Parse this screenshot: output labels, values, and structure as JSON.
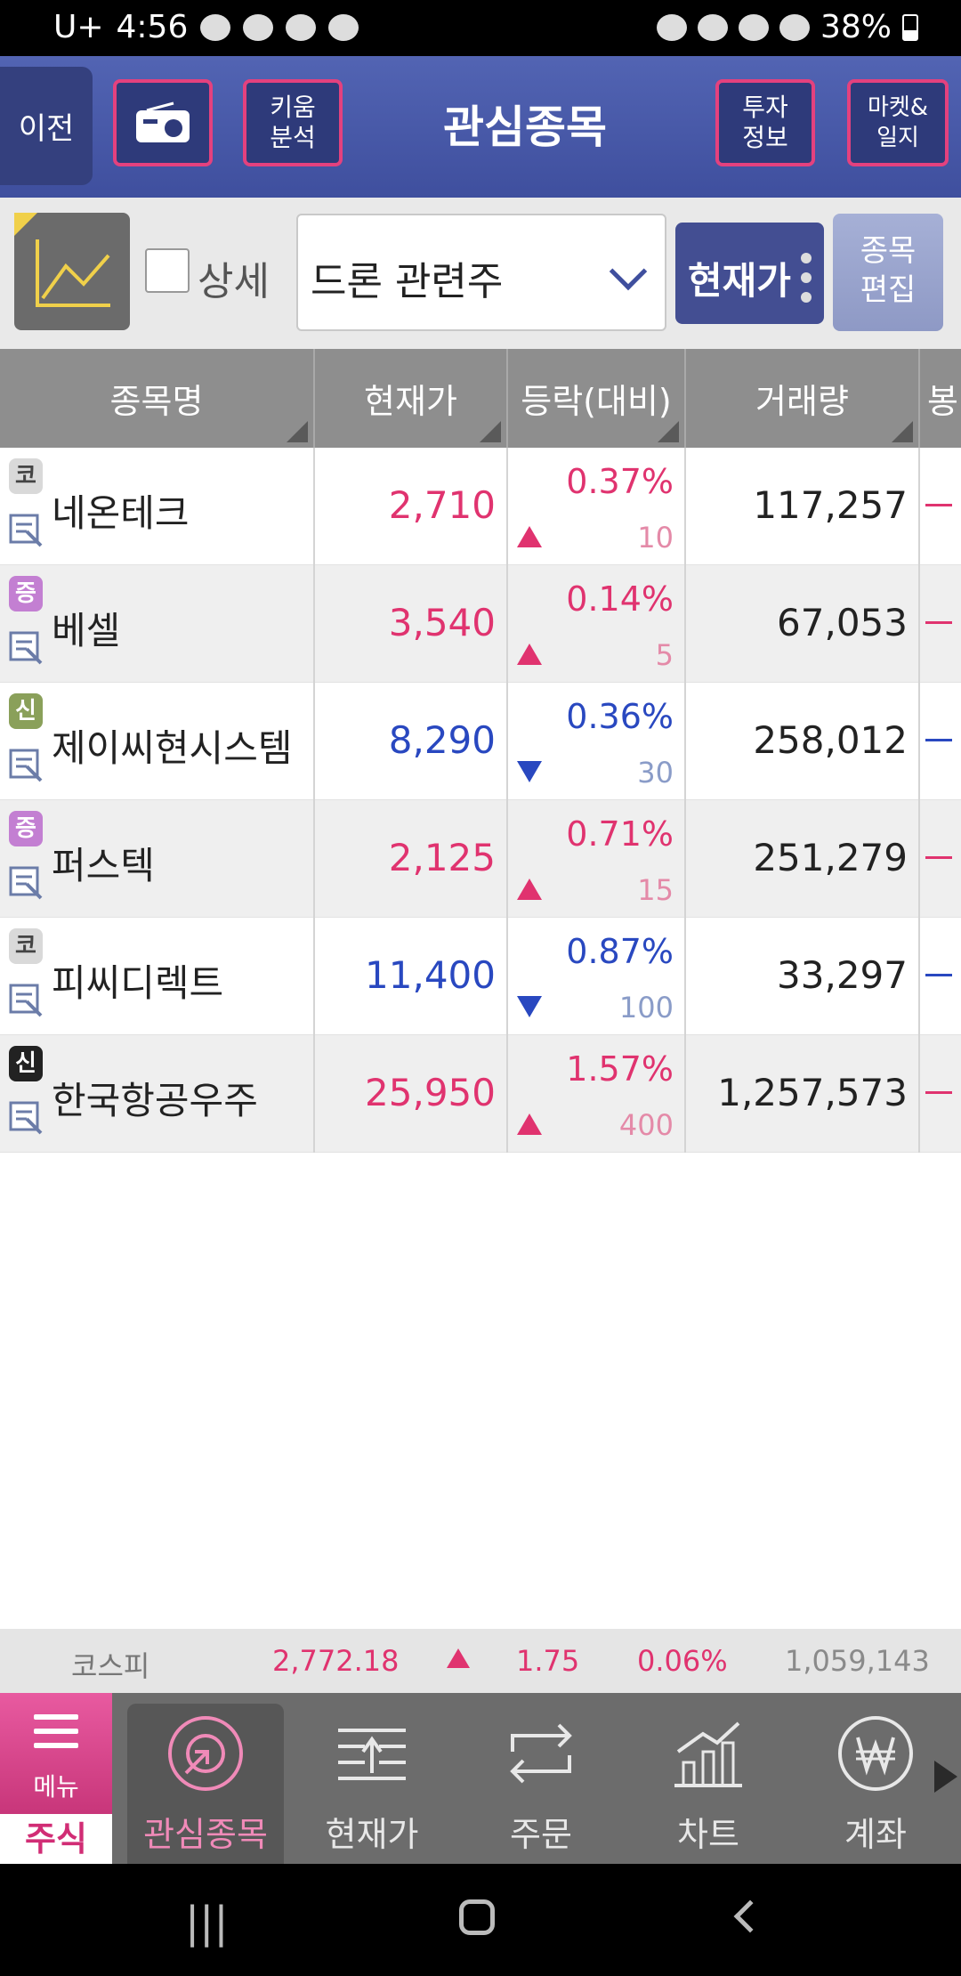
{
  "status_bar": {
    "carrier": "U+",
    "time": "4:56",
    "battery": "38%"
  },
  "header": {
    "back_label": "이전",
    "analysis_label": "키움\n분석",
    "title": "관심종목",
    "invest_label": "투자\n정보",
    "market_label": "마켓&\n일지"
  },
  "toolbar": {
    "detail_label": "상세",
    "group_selected": "드론 관련주",
    "price_button": "현재가",
    "edit_button": "종목\n편집"
  },
  "table": {
    "columns": [
      "종목명",
      "현재가",
      "등락(대비)",
      "거래량",
      "봉"
    ],
    "rows": [
      {
        "badge": "코",
        "name": "네온테크",
        "price": "2,710",
        "pct": "0.37%",
        "diff": "10",
        "direction": "up",
        "volume": "117,257"
      },
      {
        "badge": "증",
        "name": "베셀",
        "price": "3,540",
        "pct": "0.14%",
        "diff": "5",
        "direction": "up",
        "volume": "67,053"
      },
      {
        "badge": "신",
        "name": "제이씨현시스템",
        "price": "8,290",
        "pct": "0.36%",
        "diff": "30",
        "direction": "down",
        "volume": "258,012"
      },
      {
        "badge": "증",
        "name": "퍼스텍",
        "price": "2,125",
        "pct": "0.71%",
        "diff": "15",
        "direction": "up",
        "volume": "251,279"
      },
      {
        "badge": "코",
        "name": "피씨디렉트",
        "price": "11,400",
        "pct": "0.87%",
        "diff": "100",
        "direction": "down",
        "volume": "33,297"
      },
      {
        "badge": "신",
        "name": "한국항공우주",
        "price": "25,950",
        "pct": "1.57%",
        "diff": "400",
        "direction": "up",
        "volume": "1,257,573"
      }
    ]
  },
  "ticker": {
    "index_name": "코스피",
    "value": "2,772.18",
    "change": "1.75",
    "pct": "0.06%",
    "volume": "1,059,143"
  },
  "bottom_nav": {
    "menu_label": "메뉴",
    "section_label": "주식",
    "items": [
      "관심종목",
      "현재가",
      "주문",
      "차트",
      "계좌"
    ]
  },
  "colors": {
    "up": "#e0336f",
    "down": "#2948c0",
    "header_bg": "#4a5aa8",
    "accent": "#e4417e"
  }
}
